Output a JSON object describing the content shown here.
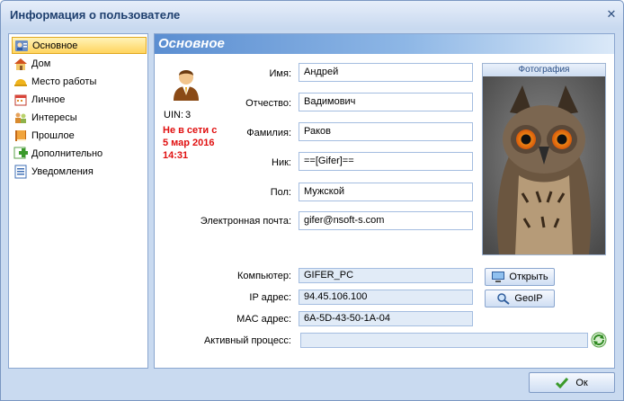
{
  "window": {
    "title": "Информация о пользователе"
  },
  "sidebar": {
    "items": [
      {
        "label": "Основное",
        "icon": "user-card-icon",
        "active": true
      },
      {
        "label": "Дом",
        "icon": "home-icon"
      },
      {
        "label": "Место работы",
        "icon": "helmet-icon"
      },
      {
        "label": "Личное",
        "icon": "calendar-icon"
      },
      {
        "label": "Интересы",
        "icon": "people-icon"
      },
      {
        "label": "Прошлое",
        "icon": "book-icon"
      },
      {
        "label": "Дополнительно",
        "icon": "plus-icon"
      },
      {
        "label": "Уведомления",
        "icon": "list-icon"
      }
    ]
  },
  "panel": {
    "title": "Основное",
    "uin_label": "UIN:",
    "uin_value": "3",
    "status_line1": "Не в сети с",
    "status_line2": "5 мар 2016",
    "status_line3": "14:31",
    "photo_caption": "Фотография",
    "fields": {
      "first_name": {
        "label": "Имя:",
        "value": "Андрей"
      },
      "patronymic": {
        "label": "Отчество:",
        "value": "Вадимович"
      },
      "last_name": {
        "label": "Фамилия:",
        "value": "Раков"
      },
      "nick": {
        "label": "Ник:",
        "value": "==[Gifer]=="
      },
      "gender": {
        "label": "Пол:",
        "value": "Мужской"
      },
      "email": {
        "label": "Электронная почта:",
        "value": "gifer@nsoft-s.com"
      }
    },
    "computer": {
      "computer_label": "Компьютер:",
      "computer_value": "GIFER_PC",
      "ip_label": "IP адрес:",
      "ip_value": "94.45.106.100",
      "mac_label": "MAC адрес:",
      "mac_value": "6A-5D-43-50-1A-04",
      "process_label": "Активный процесс:",
      "process_value": ""
    },
    "buttons": {
      "open": "Открыть",
      "geoip": "GeoIP"
    }
  },
  "footer": {
    "ok": "Ок"
  },
  "colors": {
    "status_red": "#e01010",
    "accent_blue": "#5b8ed1"
  }
}
